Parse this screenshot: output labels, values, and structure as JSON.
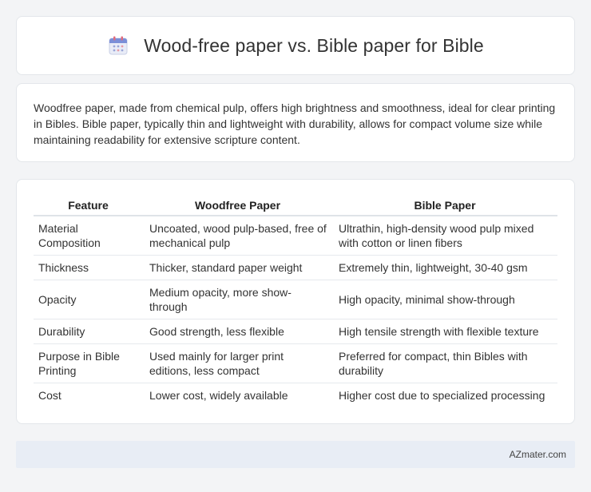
{
  "header": {
    "title": "Wood-free paper vs. Bible paper for Bible",
    "icon": "calendar-icon"
  },
  "summary": {
    "text": "Woodfree paper, made from chemical pulp, offers high brightness and smoothness, ideal for clear printing in Bibles. Bible paper, typically thin and lightweight with durability, allows for compact volume size while maintaining readability for extensive scripture content."
  },
  "table": {
    "headers": [
      "Feature",
      "Woodfree Paper",
      "Bible Paper"
    ],
    "rows": [
      [
        "Material Composition",
        "Uncoated, wood pulp-based, free of mechanical pulp",
        "Ultrathin, high-density wood pulp mixed with cotton or linen fibers"
      ],
      [
        "Thickness",
        "Thicker, standard paper weight",
        "Extremely thin, lightweight, 30-40 gsm"
      ],
      [
        "Opacity",
        "Medium opacity, more show-through",
        "High opacity, minimal show-through"
      ],
      [
        "Durability",
        "Good strength, less flexible",
        "High tensile strength with flexible texture"
      ],
      [
        "Purpose in Bible Printing",
        "Used mainly for larger print editions, less compact",
        "Preferred for compact, thin Bibles with durability"
      ],
      [
        "Cost",
        "Lower cost, widely available",
        "Higher cost due to specialized processing"
      ]
    ]
  },
  "footer": {
    "site": "AZmater.com"
  }
}
